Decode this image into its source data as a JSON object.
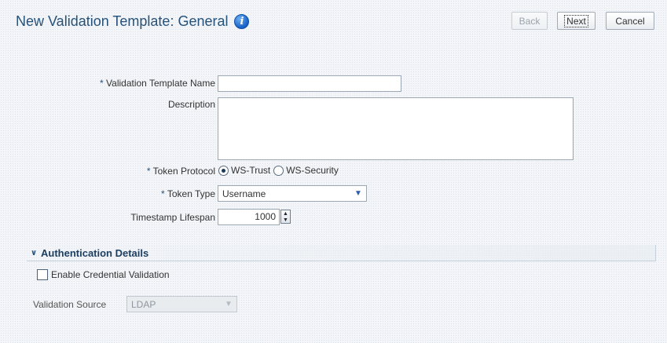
{
  "header": {
    "title": "New Validation Template: General",
    "info_icon": "info-icon",
    "buttons": {
      "back": "Back",
      "next": "Next",
      "cancel": "Cancel"
    }
  },
  "form": {
    "required_marker": "*",
    "template_name": {
      "label": "Validation Template Name",
      "value": ""
    },
    "description": {
      "label": "Description",
      "value": ""
    },
    "token_protocol": {
      "label": "Token Protocol",
      "options": [
        "WS-Trust",
        "WS-Security"
      ],
      "selected": "WS-Trust"
    },
    "token_type": {
      "label": "Token Type",
      "value": "Username"
    },
    "timestamp_lifespan": {
      "label": "Timestamp Lifespan",
      "value": "1000"
    }
  },
  "auth_section": {
    "title": "Authentication Details",
    "expanded": true,
    "enable_credential_validation": {
      "label": "Enable Credential Validation",
      "checked": false
    },
    "validation_source": {
      "label": "Validation Source",
      "value": "LDAP",
      "disabled": true
    }
  },
  "colors": {
    "title": "#26527a",
    "background": "#f3f5f8",
    "accent_blue": "#2b5da8"
  }
}
